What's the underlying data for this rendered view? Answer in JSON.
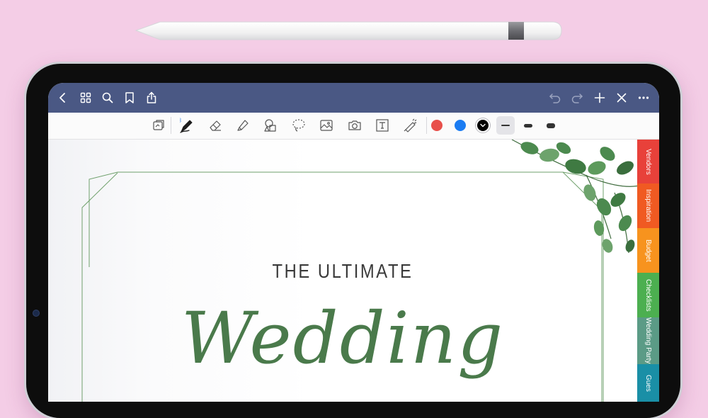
{
  "colors": {
    "background": "#f4cde6",
    "navbar": "#4a5884",
    "tab_vendors": "#e8413a",
    "tab_inspiration": "#f05a22",
    "tab_budget": "#f7931e",
    "tab_checklists": "#4caf50",
    "tab_wedding_party": "#5b9b86",
    "tab_guests": "#1a8fa6",
    "pen_red": "#e8504b",
    "pen_blue": "#1b7cf2",
    "pen_black": "#000000",
    "script_green": "#4a7a4b"
  },
  "navbar": {
    "left_icons": [
      "back-chevron-icon",
      "grid-icon",
      "search-icon",
      "bookmark-icon",
      "share-icon"
    ],
    "right_icons": [
      "undo-icon",
      "redo-icon",
      "add-icon",
      "close-icon",
      "more-icon"
    ]
  },
  "toolbar": {
    "tools": [
      "read-only-icon",
      "pen-icon",
      "eraser-icon",
      "highlighter-icon",
      "shapes-icon",
      "lasso-icon",
      "image-icon",
      "camera-icon",
      "text-box-icon",
      "laser-pointer-icon"
    ],
    "colors": [
      "red",
      "blue",
      "black"
    ],
    "selected_color": "black",
    "stroke_widths": [
      "thin",
      "medium",
      "thick"
    ],
    "selected_stroke": "thin"
  },
  "page": {
    "title_small": "THE ULTIMATE",
    "title_script": "Wedding"
  },
  "tabs": [
    {
      "label": "Vendors"
    },
    {
      "label": "Inspiration"
    },
    {
      "label": "Budget"
    },
    {
      "label": "Checklists"
    },
    {
      "label": "Wedding Party"
    },
    {
      "label": "Gues"
    }
  ]
}
